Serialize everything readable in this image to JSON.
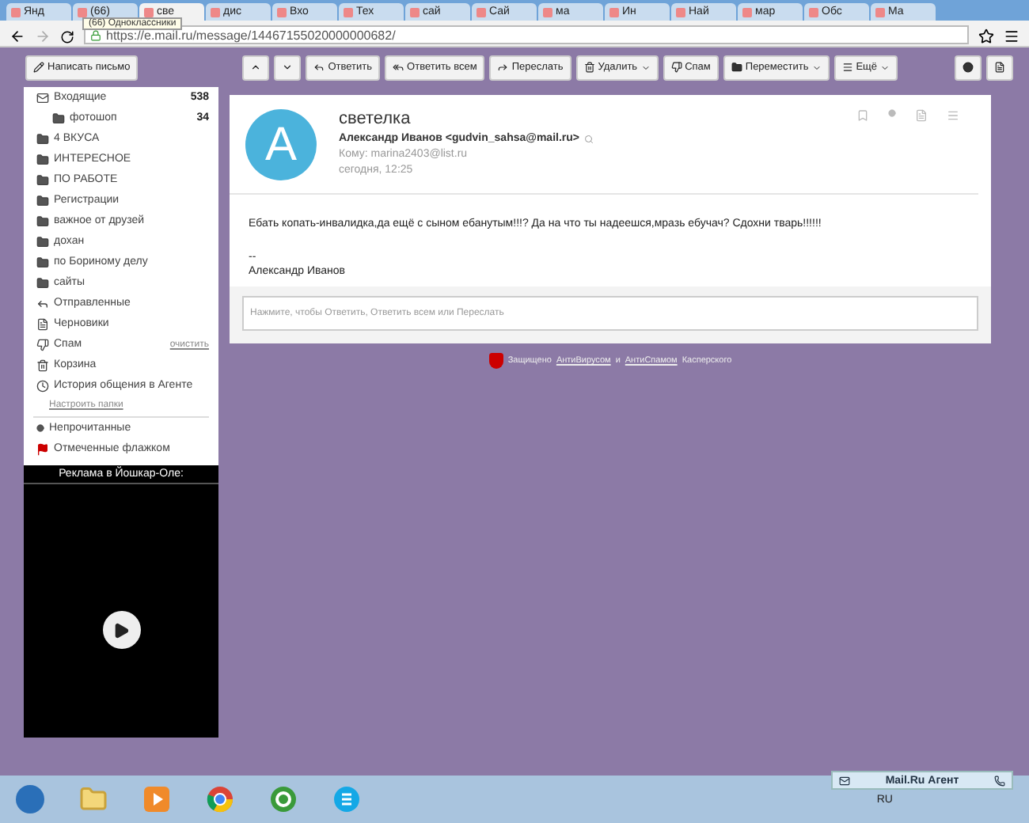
{
  "browser": {
    "tabs": [
      {
        "label": "Янд",
        "selected": false
      },
      {
        "label": "(66)",
        "selected": false
      },
      {
        "label": "све",
        "selected": true
      },
      {
        "label": "дис",
        "selected": false
      },
      {
        "label": "Вхо",
        "selected": false
      },
      {
        "label": "Тех",
        "selected": false
      },
      {
        "label": "сай",
        "selected": false
      },
      {
        "label": "Сай",
        "selected": false
      },
      {
        "label": "ма",
        "selected": false
      },
      {
        "label": "Ин",
        "selected": false
      },
      {
        "label": "Най",
        "selected": false
      },
      {
        "label": "мар",
        "selected": false
      },
      {
        "label": "Обс",
        "selected": false
      },
      {
        "label": "Ма",
        "selected": false
      }
    ],
    "tooltip": "(66) Одноклассники",
    "url": "https://e.mail.ru/message/14467155020000000682/"
  },
  "toolbar": {
    "compose": "Написать письмо",
    "reply": "Ответить",
    "reply_all": "Ответить всем",
    "forward": "Переслать",
    "delete": "Удалить",
    "spam": "Спам",
    "move": "Переместить",
    "more": "Ещё"
  },
  "sidebar": {
    "folders": [
      {
        "label": "Входящие",
        "count": "538",
        "kind": "inbox",
        "nested": false
      },
      {
        "label": "фотошоп",
        "count": "34",
        "kind": "folder",
        "nested": true
      },
      {
        "label": "4 ВКУСА",
        "kind": "folder",
        "nested": false
      },
      {
        "label": "ИНТЕРЕСНОЕ",
        "kind": "folder",
        "nested": false
      },
      {
        "label": "ПО РАБОТЕ",
        "kind": "folder",
        "nested": false
      },
      {
        "label": "Регистрации",
        "kind": "folder",
        "nested": false
      },
      {
        "label": "важное от друзей",
        "kind": "folder",
        "nested": false
      },
      {
        "label": "дохан",
        "kind": "folder",
        "nested": false
      },
      {
        "label": "по Бориному делу",
        "kind": "folder",
        "nested": false
      },
      {
        "label": "сайты",
        "kind": "folder",
        "nested": false
      },
      {
        "label": "Отправленные",
        "kind": "sent",
        "nested": false
      },
      {
        "label": "Черновики",
        "kind": "drafts",
        "nested": false
      },
      {
        "label": "Спам",
        "action": "очистить",
        "kind": "spam",
        "nested": false
      },
      {
        "label": "Корзина",
        "kind": "trash",
        "nested": false
      },
      {
        "label": "История общения в Агенте",
        "kind": "history",
        "nested": false
      }
    ],
    "settings_link": "Настроить папки",
    "filters": [
      {
        "label": "Непрочитанные",
        "kind": "unread"
      },
      {
        "label": "Отмеченные флажком",
        "kind": "flagged"
      }
    ]
  },
  "ad": {
    "title": "Реклама в Йошкар-Оле:"
  },
  "message": {
    "subject": "светелка",
    "avatar_letter": "А",
    "from": "Александр Иванов <gudvin_sahsa@mail.ru>",
    "to": "Кому: marina2403@list.ru",
    "date": "сегодня, 12:25",
    "body": "Ебать копать-инвалидка,да ещё с сыном ебанутым!!!? Да на что ты надеешся,мразь ебучач? Сдохни тварь!!!!!!",
    "signature_mark": "--",
    "signature": "Александр Иванов",
    "reply_placeholder": "Нажмите, чтобы Ответить, Ответить всем или Переслать"
  },
  "protection": {
    "prefix": "Защищено",
    "antivirus": "АнтиВирусом",
    "joiner": "и",
    "antispam": "АнтиСпамом",
    "suffix": "Касперского"
  },
  "taskbar": {
    "language": "RU",
    "agent": "Mail.Ru Агент"
  }
}
